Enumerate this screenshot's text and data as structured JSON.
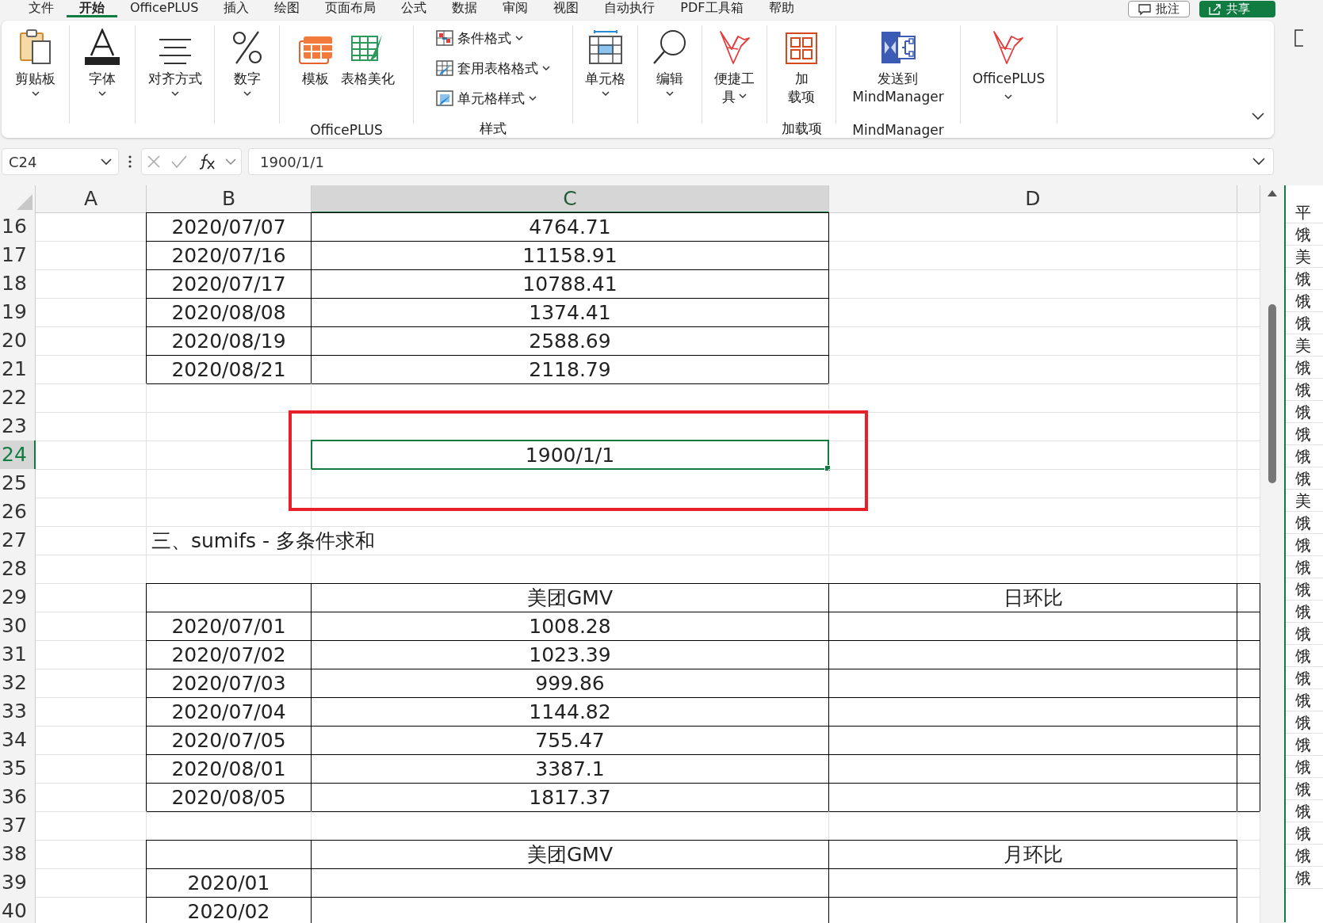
{
  "menu_tabs": [
    {
      "label": "文件",
      "selected": false
    },
    {
      "label": "开始",
      "selected": true
    },
    {
      "label": "OfficePLUS",
      "selected": false
    },
    {
      "label": "插入",
      "selected": false
    },
    {
      "label": "绘图",
      "selected": false
    },
    {
      "label": "页面布局",
      "selected": false
    },
    {
      "label": "公式",
      "selected": false
    },
    {
      "label": "数据",
      "selected": false
    },
    {
      "label": "审阅",
      "selected": false
    },
    {
      "label": "视图",
      "selected": false
    },
    {
      "label": "自动执行",
      "selected": false
    },
    {
      "label": "PDF工具箱",
      "selected": false
    },
    {
      "label": "帮助",
      "selected": false
    }
  ],
  "top_buttons": [
    {
      "kind": "comment",
      "label": "批注"
    },
    {
      "kind": "share",
      "label": "共享"
    }
  ],
  "ribbon": {
    "groups": [
      {
        "items": [
          {
            "kind": "large",
            "lines": [
              "剪贴板"
            ],
            "caret": true
          }
        ]
      },
      {
        "items": [
          {
            "kind": "large",
            "lines": [
              "字体"
            ],
            "caret": true
          }
        ]
      },
      {
        "items": [
          {
            "kind": "large",
            "lines": [
              "对齐方式"
            ],
            "caret": true
          }
        ]
      },
      {
        "items": [
          {
            "kind": "large",
            "lines": [
              "数字"
            ],
            "caret": true
          }
        ]
      },
      {
        "label": "OfficePLUS",
        "items": [
          {
            "kind": "large",
            "lines": [
              "模板"
            ],
            "caret": false
          },
          {
            "kind": "large",
            "lines": [
              "表格美化"
            ],
            "caret": false
          }
        ]
      },
      {
        "label": "样式",
        "items": [
          {
            "kind": "small",
            "lines": [
              "条件格式"
            ],
            "caret": true
          },
          {
            "kind": "small",
            "lines": [
              "套用表格格式"
            ],
            "caret": true
          },
          {
            "kind": "small",
            "lines": [
              "单元格样式"
            ],
            "caret": true
          }
        ]
      },
      {
        "items": [
          {
            "kind": "large",
            "lines": [
              "单元格"
            ],
            "caret": true
          }
        ]
      },
      {
        "items": [
          {
            "kind": "large",
            "lines": [
              "编辑"
            ],
            "caret": true
          }
        ]
      },
      {
        "items": [
          {
            "kind": "large",
            "lines": [
              "便捷工",
              "具"
            ],
            "caret": true
          }
        ]
      },
      {
        "label": "加载项",
        "items": [
          {
            "kind": "large",
            "lines": [
              "加",
              "载项"
            ],
            "caret": false
          }
        ]
      },
      {
        "label": "MindManager",
        "items": [
          {
            "kind": "large",
            "lines": [
              "发送到",
              "MindManager"
            ],
            "caret": false
          }
        ]
      },
      {
        "items": [
          {
            "kind": "large",
            "lines": [
              "OfficePLUS"
            ],
            "caret": true
          }
        ]
      }
    ]
  },
  "formula_bar": {
    "name_box": "C24",
    "formula": "1900/1/1"
  },
  "columns": [
    {
      "label": "A",
      "selected": false
    },
    {
      "label": "B",
      "selected": false
    },
    {
      "label": "C",
      "selected": true
    },
    {
      "label": "D",
      "selected": false
    }
  ],
  "rows": [
    {
      "number": "16",
      "kind": "data",
      "active": false,
      "cells": {
        "B": "2020/07/07",
        "C": "4764.71"
      },
      "boxed": [
        false,
        true,
        true,
        false,
        false
      ]
    },
    {
      "number": "17",
      "kind": "data",
      "active": false,
      "cells": {
        "B": "2020/07/16",
        "C": "11158.91"
      },
      "boxed": [
        false,
        true,
        true,
        false,
        false
      ]
    },
    {
      "number": "18",
      "kind": "data",
      "active": false,
      "cells": {
        "B": "2020/07/17",
        "C": "10788.41"
      },
      "boxed": [
        false,
        true,
        true,
        false,
        false
      ]
    },
    {
      "number": "19",
      "kind": "data",
      "active": false,
      "cells": {
        "B": "2020/08/08",
        "C": "1374.41"
      },
      "boxed": [
        false,
        true,
        true,
        false,
        false
      ]
    },
    {
      "number": "20",
      "kind": "data",
      "active": false,
      "cells": {
        "B": "2020/08/19",
        "C": "2588.69"
      },
      "boxed": [
        false,
        true,
        true,
        false,
        false
      ]
    },
    {
      "number": "21",
      "kind": "data",
      "active": false,
      "cells": {
        "B": "2020/08/21",
        "C": "2118.79"
      },
      "boxed": [
        false,
        true,
        true,
        false,
        false
      ]
    },
    {
      "number": "22",
      "kind": "data",
      "active": false,
      "cells": {},
      "boxed": [
        false,
        false,
        false,
        false,
        false
      ]
    },
    {
      "number": "23",
      "kind": "data",
      "active": false,
      "cells": {},
      "boxed": [
        false,
        false,
        false,
        false,
        false
      ]
    },
    {
      "number": "24",
      "kind": "data",
      "active": true,
      "cells": {
        "C": "1900/1/1"
      },
      "boxed": [
        false,
        false,
        false,
        false,
        false
      ]
    },
    {
      "number": "25",
      "kind": "data",
      "active": false,
      "cells": {},
      "boxed": [
        false,
        false,
        false,
        false,
        false
      ]
    },
    {
      "number": "26",
      "kind": "data",
      "active": false,
      "cells": {},
      "boxed": [
        false,
        false,
        false,
        false,
        false
      ]
    },
    {
      "number": "27",
      "kind": "heading",
      "active": false,
      "cells": {
        "B": "三、sumifs - 多条件求和"
      },
      "boxed": [
        false,
        false,
        false,
        false,
        false
      ]
    },
    {
      "number": "28",
      "kind": "data",
      "active": false,
      "cells": {},
      "boxed": [
        false,
        false,
        false,
        false,
        false
      ]
    },
    {
      "number": "29",
      "kind": "data",
      "active": false,
      "cells": {
        "C": "美团GMV",
        "D": "日环比"
      },
      "boxed": [
        false,
        true,
        true,
        true,
        true
      ]
    },
    {
      "number": "30",
      "kind": "data",
      "active": false,
      "cells": {
        "B": "2020/07/01",
        "C": "1008.28"
      },
      "boxed": [
        false,
        true,
        true,
        true,
        true
      ]
    },
    {
      "number": "31",
      "kind": "data",
      "active": false,
      "cells": {
        "B": "2020/07/02",
        "C": "1023.39"
      },
      "boxed": [
        false,
        true,
        true,
        true,
        true
      ]
    },
    {
      "number": "32",
      "kind": "data",
      "active": false,
      "cells": {
        "B": "2020/07/03",
        "C": "999.86"
      },
      "boxed": [
        false,
        true,
        true,
        true,
        true
      ]
    },
    {
      "number": "33",
      "kind": "data",
      "active": false,
      "cells": {
        "B": "2020/07/04",
        "C": "1144.82"
      },
      "boxed": [
        false,
        true,
        true,
        true,
        true
      ]
    },
    {
      "number": "34",
      "kind": "data",
      "active": false,
      "cells": {
        "B": "2020/07/05",
        "C": "755.47"
      },
      "boxed": [
        false,
        true,
        true,
        true,
        true
      ]
    },
    {
      "number": "35",
      "kind": "data",
      "active": false,
      "cells": {
        "B": "2020/08/01",
        "C": "3387.1"
      },
      "boxed": [
        false,
        true,
        true,
        true,
        true
      ]
    },
    {
      "number": "36",
      "kind": "data",
      "active": false,
      "cells": {
        "B": "2020/08/05",
        "C": "1817.37"
      },
      "boxed": [
        false,
        true,
        true,
        true,
        true
      ]
    },
    {
      "number": "37",
      "kind": "data",
      "active": false,
      "cells": {},
      "boxed": [
        false,
        false,
        false,
        false,
        false
      ]
    },
    {
      "number": "38",
      "kind": "data",
      "active": false,
      "cells": {
        "C": "美团GMV",
        "D": "月环比"
      },
      "boxed": [
        false,
        true,
        true,
        true,
        false
      ]
    },
    {
      "number": "39",
      "kind": "data",
      "active": false,
      "cells": {
        "B": "2020/01"
      },
      "boxed": [
        false,
        true,
        true,
        true,
        false
      ]
    },
    {
      "number": "40",
      "kind": "data",
      "active": false,
      "cells": {
        "B": "2020/02"
      },
      "boxed": [
        false,
        true,
        true,
        true,
        false
      ]
    }
  ],
  "annotation": {
    "kind": "rectangle"
  },
  "side_window": {
    "header": "平",
    "cells": [
      "饿",
      "美",
      "饿",
      "饿",
      "饿",
      "美",
      "饿",
      "饿",
      "饿",
      "饿",
      "饿",
      "饿",
      "美",
      "饿",
      "饿",
      "饿",
      "饿",
      "饿",
      "饿",
      "饿",
      "饿",
      "饿",
      "饿",
      "饿",
      "饿",
      "饿",
      "饿",
      "饿",
      "饿",
      "饿"
    ]
  }
}
